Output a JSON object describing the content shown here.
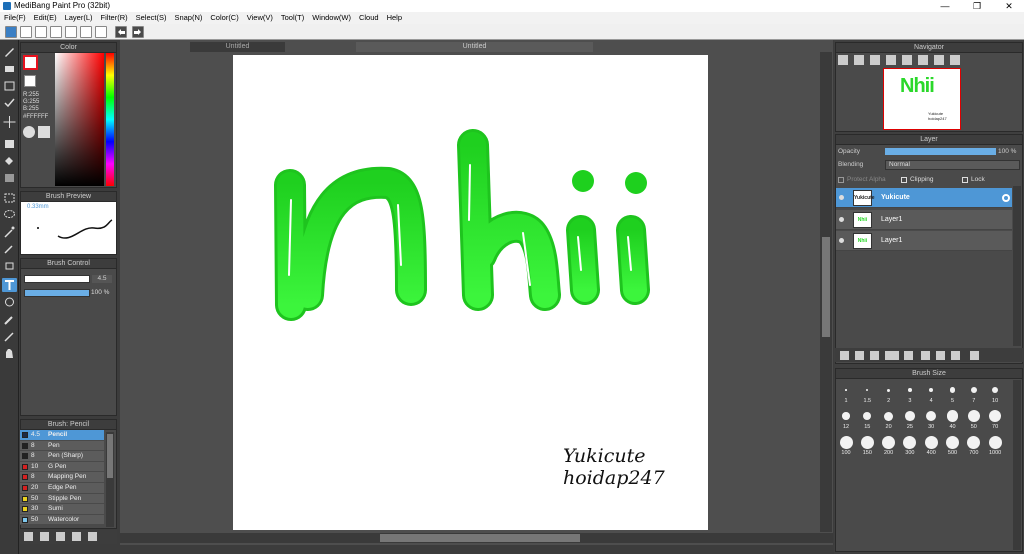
{
  "window": {
    "title": "MediBang Paint Pro (32bit)",
    "minimize": "—",
    "maximize": "❐",
    "close": "✕"
  },
  "menu": [
    "File(F)",
    "Edit(E)",
    "Layer(L)",
    "Filter(R)",
    "Select(S)",
    "Snap(N)",
    "Color(C)",
    "View(V)",
    "Tool(T)",
    "Window(W)",
    "Cloud",
    "Help"
  ],
  "tabs": [
    "Untitled",
    "Untitled"
  ],
  "color_panel": {
    "title": "Color",
    "r": "R:255",
    "g": "G:255",
    "b": "B:255",
    "hex": "#FFFFFF",
    "primary": "#e8121e",
    "secondary": "#ffffff"
  },
  "brush_preview": {
    "title": "Brush Preview",
    "size": "0.33mm"
  },
  "brush_control": {
    "title": "Brush Control",
    "size_value": "4.5",
    "opacity_value": "100 %",
    "size_level": 0.9,
    "opacity_level": 1.0
  },
  "brush_list": {
    "title": "Brush: Pencil",
    "items": [
      {
        "size": "4.5",
        "name": "Pencil",
        "color": "#1c2a44"
      },
      {
        "size": "8",
        "name": "Pen",
        "color": "#222222"
      },
      {
        "size": "8",
        "name": "Pen (Sharp)",
        "color": "#222222"
      },
      {
        "size": "10",
        "name": "G Pen",
        "color": "#d42020"
      },
      {
        "size": "8",
        "name": "Mapping Pen",
        "color": "#d42020"
      },
      {
        "size": "20",
        "name": "Edge Pen",
        "color": "#d42020"
      },
      {
        "size": "50",
        "name": "Stipple Pen",
        "color": "#e8d020"
      },
      {
        "size": "30",
        "name": "Sumi",
        "color": "#e8d020"
      },
      {
        "size": "50",
        "name": "Watercolor",
        "color": "#7ec8ee"
      }
    ]
  },
  "navigator": {
    "title": "Navigator",
    "thumb_text": "Nhii",
    "thumb_caption1": "Yukicute",
    "thumb_caption2": "hoidap247"
  },
  "layer_panel": {
    "title": "Layer",
    "opacity_label": "Opacity",
    "opacity_value": "100 %",
    "opacity_level": 1.0,
    "blending_label": "Blending",
    "blending_value": "Normal",
    "protect_alpha": "Protect Alpha",
    "clipping": "Clipping",
    "lock": "Lock",
    "layers": [
      {
        "name": "Yukicute",
        "selected": true,
        "thumb": "Yukicute"
      },
      {
        "name": "Layer1",
        "selected": false,
        "thumb": "Nhii"
      },
      {
        "name": "Layer1",
        "selected": false,
        "thumb": "Nhii"
      }
    ]
  },
  "brush_size": {
    "title": "Brush Size",
    "sizes": [
      "1",
      "1.5",
      "2",
      "3",
      "4",
      "5",
      "7",
      "10",
      "12",
      "15",
      "20",
      "25",
      "30",
      "40",
      "50",
      "70",
      "100",
      "150",
      "200",
      "300",
      "400",
      "500",
      "700",
      "1000"
    ]
  },
  "canvas": {
    "signature_line1": "Yukicute",
    "signature_line2": "hoidap247",
    "art_color": "#22dd22"
  }
}
